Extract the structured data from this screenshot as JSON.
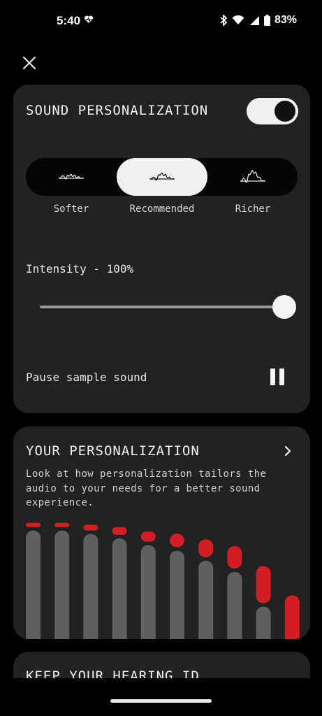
{
  "status_bar": {
    "time": "5:40",
    "battery": "83%"
  },
  "sound_card": {
    "title": "SOUND PERSONALIZATION",
    "toggle_on": true,
    "options": [
      {
        "label": "Softer",
        "selected": false
      },
      {
        "label": "Recommended",
        "selected": true
      },
      {
        "label": "Richer",
        "selected": false
      }
    ],
    "intensity_label": "Intensity - 100%",
    "intensity_value": 1.0,
    "pause_label": "Pause sample sound"
  },
  "personalization_card": {
    "title": "YOUR PERSONALIZATION",
    "description": "Look at how personalization tailors the audio to your needs for a better sound experience.",
    "bars": [
      {
        "base": 0.97,
        "boost": 0.03
      },
      {
        "base": 0.97,
        "boost": 0.03
      },
      {
        "base": 0.94,
        "boost": 0.05
      },
      {
        "base": 0.9,
        "boost": 0.07
      },
      {
        "base": 0.84,
        "boost": 0.09
      },
      {
        "base": 0.79,
        "boost": 0.12
      },
      {
        "base": 0.7,
        "boost": 0.16
      },
      {
        "base": 0.6,
        "boost": 0.2
      },
      {
        "base": 0.29,
        "boost": 0.33
      },
      {
        "base": 0.0,
        "boost": 0.39
      }
    ],
    "colors": {
      "base": "#5f5f5f",
      "boost": "#d21d24"
    }
  },
  "hearing_card": {
    "title": "KEEP YOUR HEARING ID"
  },
  "icons": {
    "close": "close-icon",
    "chevron": "chevron-right-icon",
    "pause": "pause-icon",
    "toggle": "toggle-icon"
  }
}
